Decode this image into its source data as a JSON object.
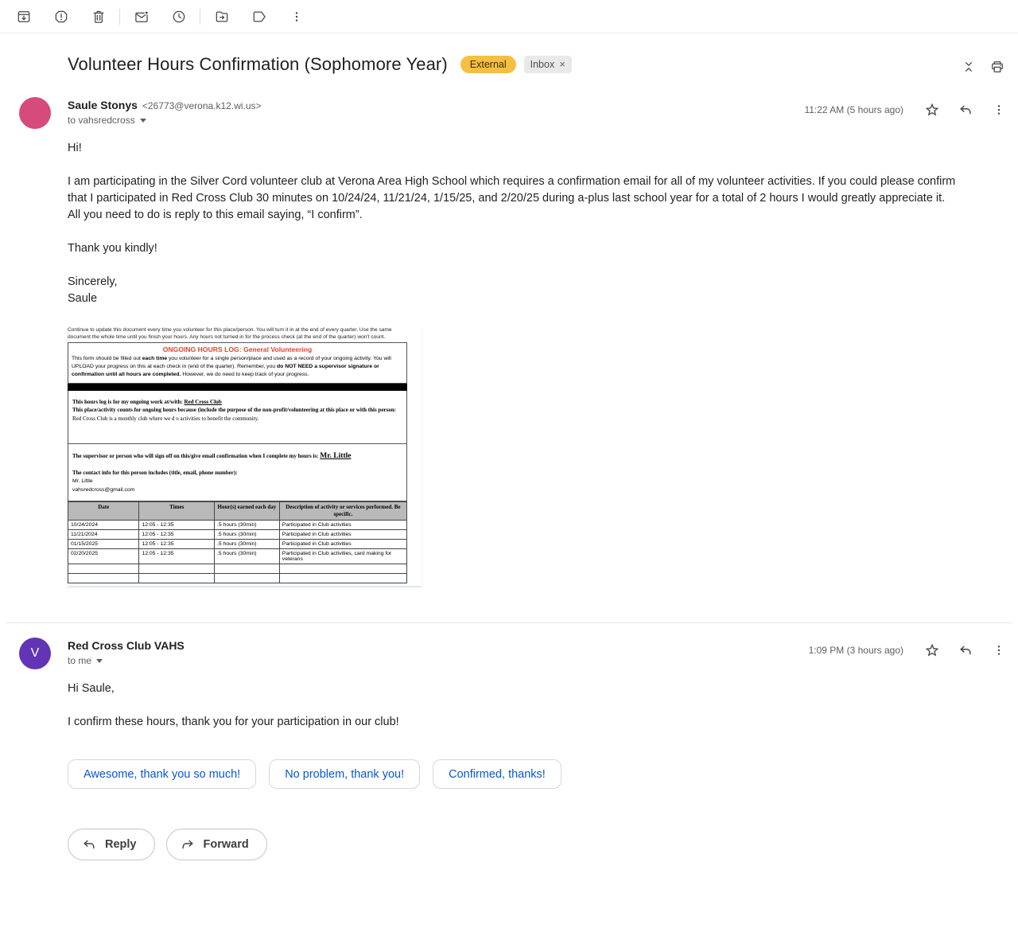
{
  "colors": {
    "external_badge_bg": "#f4bf42",
    "avatar_sender1": "#d64a7c",
    "avatar_sender2": "#6334b5",
    "smart_reply_blue": "#0b57d0",
    "doc_title_red": "#e8432e",
    "icon_gray": "#444746"
  },
  "toolbar": {
    "icons": [
      "archive",
      "report-spam",
      "delete",
      "mark-as-unread",
      "snooze",
      "move-to",
      "labels",
      "more"
    ]
  },
  "header": {
    "subject": "Volunteer Hours Confirmation (Sophomore Year)",
    "external_badge": "External",
    "inbox_badge": "Inbox",
    "inbox_close": "×"
  },
  "messages": [
    {
      "sender_name": "Saule Stonys",
      "sender_email": "<26773@verona.k12.wi.us>",
      "recipient": "to vahsredcross",
      "timestamp": "11:22 AM (5 hours ago)",
      "greeting": "Hi!",
      "para1": "I am participating in the Silver Cord volunteer club at Verona Area High School which requires a confirmation email for all of my volunteer activities. If you could please confirm that I participated in Red Cross Club 30 minutes on 10/24/24, 11/21/24, 1/15/25, and 2/20/25 during a-plus last school year for a total of 2 hours I would greatly appreciate it.",
      "para2": "All you need to do is reply to this email saying, “I confirm”.",
      "closing": "Thank you kindly!",
      "signoff1": "Sincerely,",
      "signoff2": "Saule"
    },
    {
      "sender_name": "Red Cross Club VAHS",
      "avatar_letter": "V",
      "recipient": "to me",
      "timestamp": "1:09 PM (3 hours ago)",
      "greeting": "Hi Saule,",
      "para1": "I confirm these hours, thank you for your participation in our club!"
    }
  ],
  "document": {
    "top_note": "Continue to update this document every time you volunteer for this place/person. You will turn it in at the end of every quarter. Use the same document the whole time until you finish your hours. Any hours not turned in for the process check (at the end of the quarter) won't count.",
    "title": "ONGOING HOURS LOG: General Volunteering",
    "intro_pre": "This form should be filled out ",
    "intro_b1": "each time",
    "intro_mid1": " you volunteer for a single person/place and used as a record of your ongoing activity. You will UPLOAD your progress on this at each check in (end of the quarter). Remember, you ",
    "intro_b2": "do NOT NEED a supervisor signature or confirmation until all hours are completed.",
    "intro_mid2": " However, we do need to keep track of your progress.",
    "work_with_label": "This hours log is for my ongoing work at/with: ",
    "work_with_value": "Red Cross Club",
    "counts_label": "This place/activity counts for ongoing hours because (include the purpose of the non-profit/volunteering at this place or with this person: ",
    "counts_value": "Red Cross Club is a monthly club where we d o activities to benefit the community.",
    "supervisor_label": "The supervisor or person who will sign off on this/give email confirmation when I complete my hours is: ",
    "supervisor_value": "Mr. Little",
    "contact_label": "The contact info for this person includes (title, email, phone number):",
    "contact_name": "Mr. Little",
    "contact_email": "vahsredcross@gmail.com",
    "table": {
      "headers": [
        "Date",
        "Times",
        "Hour(s) earned each day",
        "Description of activity or services performed. Be specific."
      ],
      "rows": [
        [
          "10/24/2024",
          "12:05 - 12:35",
          ".5 hours (30min)",
          "Participated in Club activities"
        ],
        [
          "11/21/2024",
          "12:05 - 12:35",
          ".5 hours (30min)",
          "Participated in Club activities"
        ],
        [
          "01/15/2025",
          "12:05 - 12:35",
          ".5 hours (30min)",
          "Participated in Club activities"
        ],
        [
          "02/20/2025",
          "12:05 - 12:35",
          ".5 hours (30min)",
          "Participated in Club activities, card making for veterans"
        ],
        [
          "",
          "",
          "",
          ""
        ],
        [
          "",
          "",
          "",
          ""
        ]
      ]
    }
  },
  "smart_replies": [
    "Awesome, thank you so much!",
    "No problem, thank you!",
    "Confirmed, thanks!"
  ],
  "actions": {
    "reply": "Reply",
    "forward": "Forward"
  }
}
